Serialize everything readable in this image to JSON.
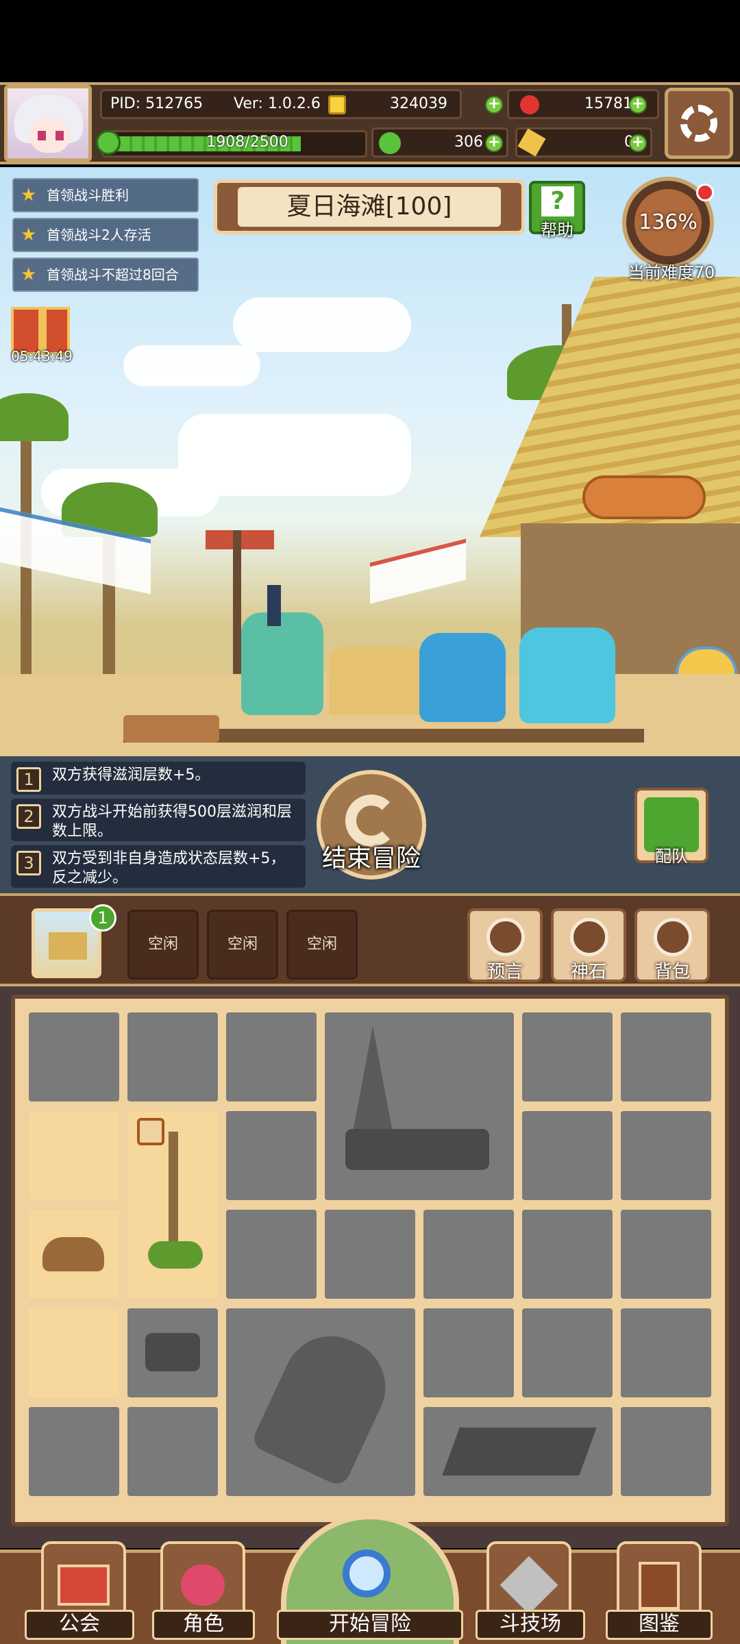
{
  "header": {
    "pid_label": "PID: 512765",
    "version_label": "Ver: 1.0.2.6",
    "gold": "324039",
    "gems": "15781",
    "energy": "1908/2500",
    "energy_fraction": 0.7632,
    "clover": "306",
    "fragments": "0"
  },
  "quests": [
    "首领战斗胜利",
    "首领战斗2人存活",
    "首领战斗不超过8回合"
  ],
  "stage": {
    "title": "夏日海滩[100]",
    "help_label": "帮助",
    "difficulty_value": "136%",
    "difficulty_label": "当前难度70"
  },
  "gift": {
    "timer": "05:43:49"
  },
  "effects": [
    {
      "num": "1",
      "text": "双方获得滋润层数+5。"
    },
    {
      "num": "2",
      "text": "双方战斗开始前获得500层滋润和层数上限。"
    },
    {
      "num": "3",
      "text": "双方受到非自身造成状态层数+5，反之减少。"
    }
  ],
  "actions": {
    "end_adventure": "结束冒险",
    "team": "配队"
  },
  "slots": {
    "map_badge": "1",
    "items": [
      "空闲",
      "空闲",
      "空闲"
    ]
  },
  "side_buttons": [
    "预言",
    "神石",
    "背包"
  ],
  "nav": [
    "公会",
    "角色",
    "开始冒险",
    "斗技场",
    "图鉴"
  ],
  "colors": {
    "accent": "#c9a46a",
    "panel": "#4a3426",
    "green": "#4da62f"
  }
}
